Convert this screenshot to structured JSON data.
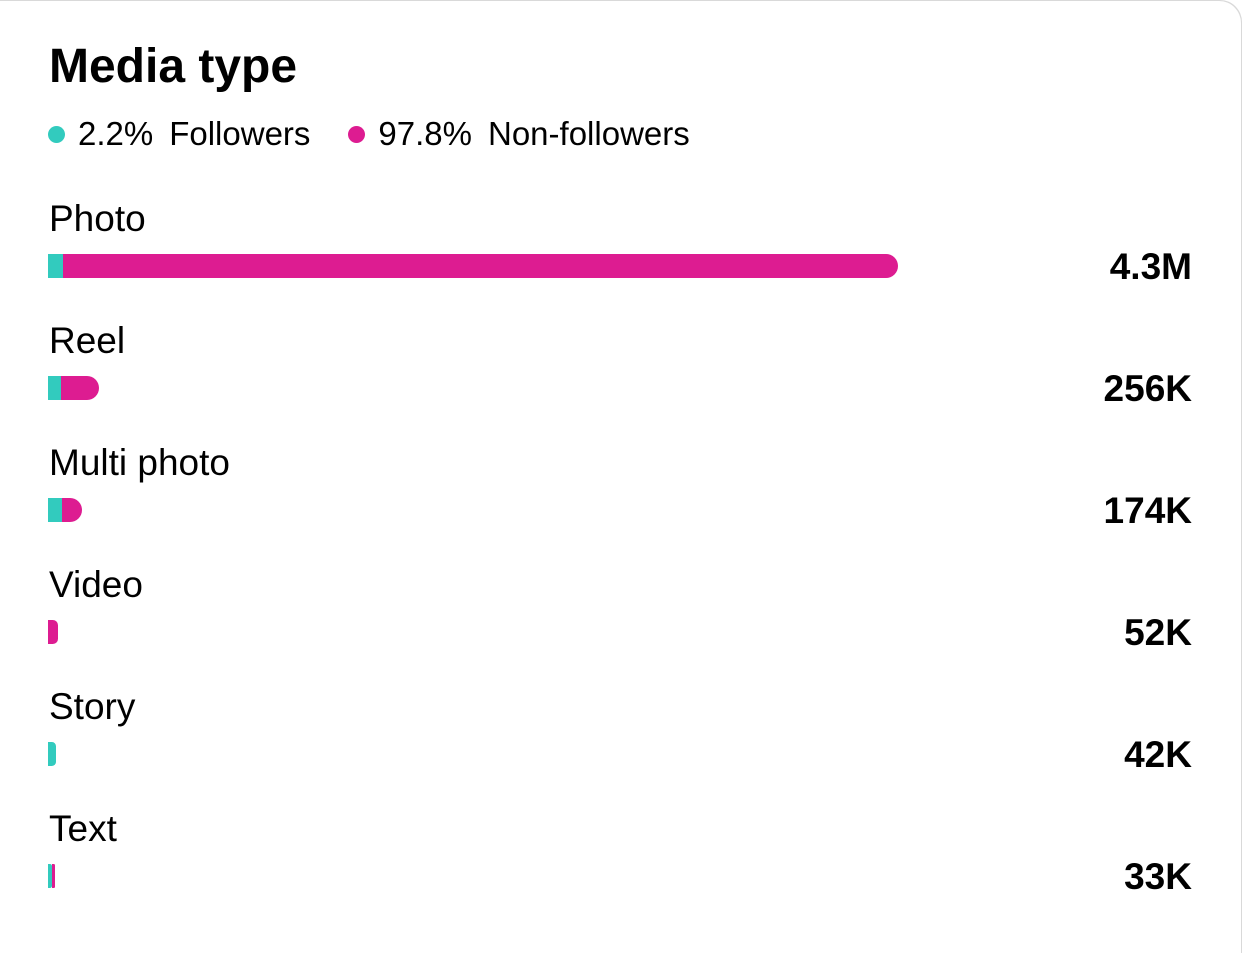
{
  "card": {
    "title": "Media type",
    "legend": [
      {
        "pct": "2.2%",
        "label": "Followers",
        "color": "#32CBBE"
      },
      {
        "pct": "97.8%",
        "label": "Non-followers",
        "color": "#DD1C91"
      }
    ]
  },
  "chart_data": {
    "type": "bar",
    "orientation": "horizontal",
    "stacked": true,
    "title": "Media type",
    "categories": [
      "Photo",
      "Reel",
      "Multi photo",
      "Video",
      "Story",
      "Text"
    ],
    "value_labels": [
      "4.3M",
      "256K",
      "174K",
      "52K",
      "42K",
      "33K"
    ],
    "totals": [
      4300000,
      256000,
      174000,
      52000,
      42000,
      33000
    ],
    "series": [
      {
        "name": "Followers",
        "color": "#32CBBE",
        "share": [
          0.018,
          0.25,
          0.4,
          0.0,
          1.0,
          0.6
        ]
      },
      {
        "name": "Non-followers",
        "color": "#DD1C91",
        "share": [
          0.982,
          0.75,
          0.6,
          1.0,
          0.0,
          0.4
        ]
      }
    ],
    "legend_position": "top-left",
    "grid": false
  }
}
